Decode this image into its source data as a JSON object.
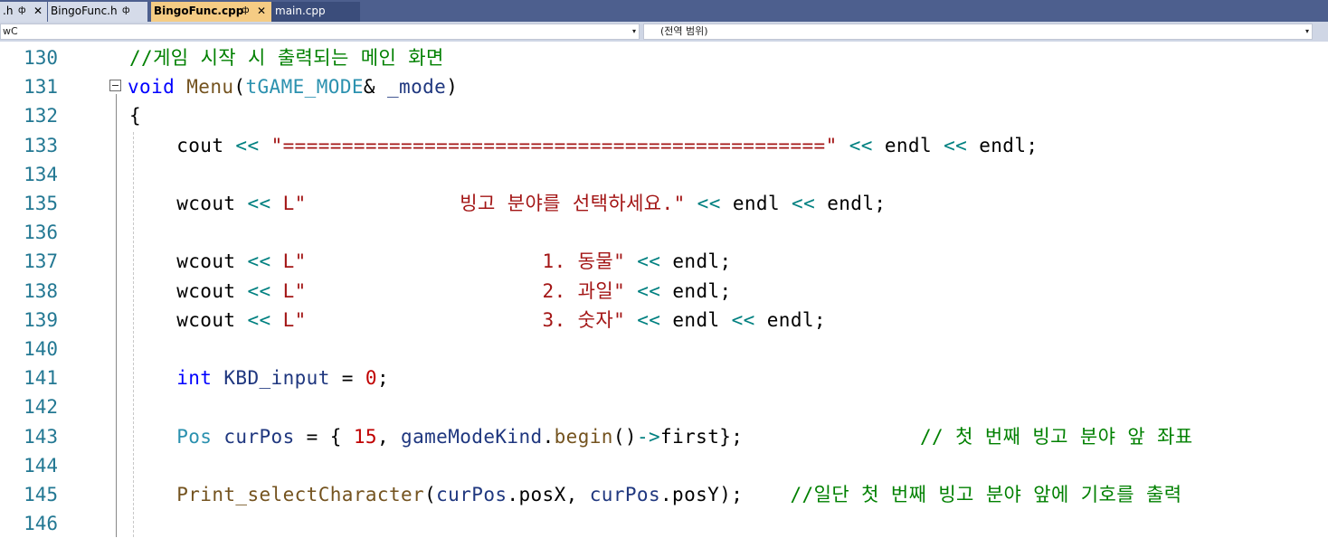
{
  "tabs": [
    {
      "label": ".h",
      "pin": "ф",
      "close": "✕"
    },
    {
      "label": "BingoFunc.h",
      "pin": "ф"
    },
    {
      "label": "BingoFunc.cpp",
      "pin": "ф",
      "close": "✕"
    },
    {
      "label": "main.cpp"
    }
  ],
  "nav": {
    "left_combo": "wC",
    "right_combo": "(전역 범위)",
    "arrow": "▾"
  },
  "editor": {
    "lines": [
      {
        "num": "130",
        "text": "//게임 시작 시 출력되는 메인 화면"
      },
      {
        "num": "131",
        "text": "void Menu(tGAME_MODE& _mode)"
      },
      {
        "num": "132",
        "text": "{"
      },
      {
        "num": "133",
        "text": "    cout << \"==============================================\" << endl << endl;"
      },
      {
        "num": "134",
        "text": ""
      },
      {
        "num": "135",
        "text": "    wcout << L\"             빙고 분야를 선택하세요.\" << endl << endl;"
      },
      {
        "num": "136",
        "text": ""
      },
      {
        "num": "137",
        "text": "    wcout << L\"                    1. 동물\" << endl;"
      },
      {
        "num": "138",
        "text": "    wcout << L\"                    2. 과일\" << endl;"
      },
      {
        "num": "139",
        "text": "    wcout << L\"                    3. 숫자\" << endl << endl;"
      },
      {
        "num": "140",
        "text": ""
      },
      {
        "num": "141",
        "text": "    int KBD_input = 0;"
      },
      {
        "num": "142",
        "text": ""
      },
      {
        "num": "143",
        "text": "    Pos curPos = { 15, gameModeKind.begin()->first};               // 첫 번째 빙고 분야 앞 좌표"
      },
      {
        "num": "144",
        "text": ""
      },
      {
        "num": "145",
        "text": "    Print_selectCharacter(curPos.posX, curPos.posY);    //일단 첫 번째 빙고 분야 앞에 기호를 출력"
      },
      {
        "num": "146",
        "text": ""
      }
    ],
    "tokens": {
      "l130": [
        "//게임 시작 시 출력되는 메인 화면"
      ],
      "l131": [
        "void",
        " ",
        "Menu",
        "(",
        "tGAME_MODE",
        "& ",
        "_mode",
        ")"
      ],
      "l132": [
        "{"
      ],
      "l133": [
        "    ",
        "cout",
        " ",
        "<<",
        " ",
        "\"==============================================\"",
        " ",
        "<<",
        " ",
        "endl",
        " ",
        "<<",
        " ",
        "endl",
        ";"
      ],
      "l135": [
        "    ",
        "wcout",
        " ",
        "<<",
        " ",
        "L",
        "\"             빙고 분야를 선택하세요.\"",
        " ",
        "<<",
        " ",
        "endl",
        " ",
        "<<",
        " ",
        "endl",
        ";"
      ],
      "l137": [
        "    ",
        "wcout",
        " ",
        "<<",
        " ",
        "L",
        "\"                    1. 동물\"",
        " ",
        "<<",
        " ",
        "endl",
        ";"
      ],
      "l138": [
        "    ",
        "wcout",
        " ",
        "<<",
        " ",
        "L",
        "\"                    2. 과일\"",
        " ",
        "<<",
        " ",
        "endl",
        ";"
      ],
      "l139": [
        "    ",
        "wcout",
        " ",
        "<<",
        " ",
        "L",
        "\"                    3. 숫자\"",
        " ",
        "<<",
        " ",
        "endl",
        " ",
        "<<",
        " ",
        "endl",
        ";"
      ],
      "l141": [
        "    ",
        "int",
        " ",
        "KBD_input",
        " = ",
        "0",
        ";"
      ],
      "l143": [
        "    ",
        "Pos",
        " ",
        "curPos",
        " = { ",
        "15",
        ", ",
        "gameModeKind",
        ".",
        "begin",
        "()",
        "->",
        "first",
        "};",
        "               ",
        "// 첫 번째 빙고 분야 앞 좌표"
      ],
      "l145": [
        "    ",
        "Print_selectCharacter",
        "(",
        "curPos",
        ".",
        "posX",
        ", ",
        "curPos",
        ".",
        "posY",
        ");",
        "    ",
        "//일단 첫 번째 빙고 분야 앞에 기호를 출력"
      ]
    }
  },
  "colors": {
    "keyword": "#0000ff",
    "type": "#2b91af",
    "function": "#74531f",
    "string": "#a31515",
    "comment": "#008000",
    "operator": "#008080",
    "variable": "#1f377f",
    "number": "#c00000",
    "line_number": "#237893",
    "tab_active": "#f5cc84",
    "tabbar": "#4d5f8e"
  }
}
